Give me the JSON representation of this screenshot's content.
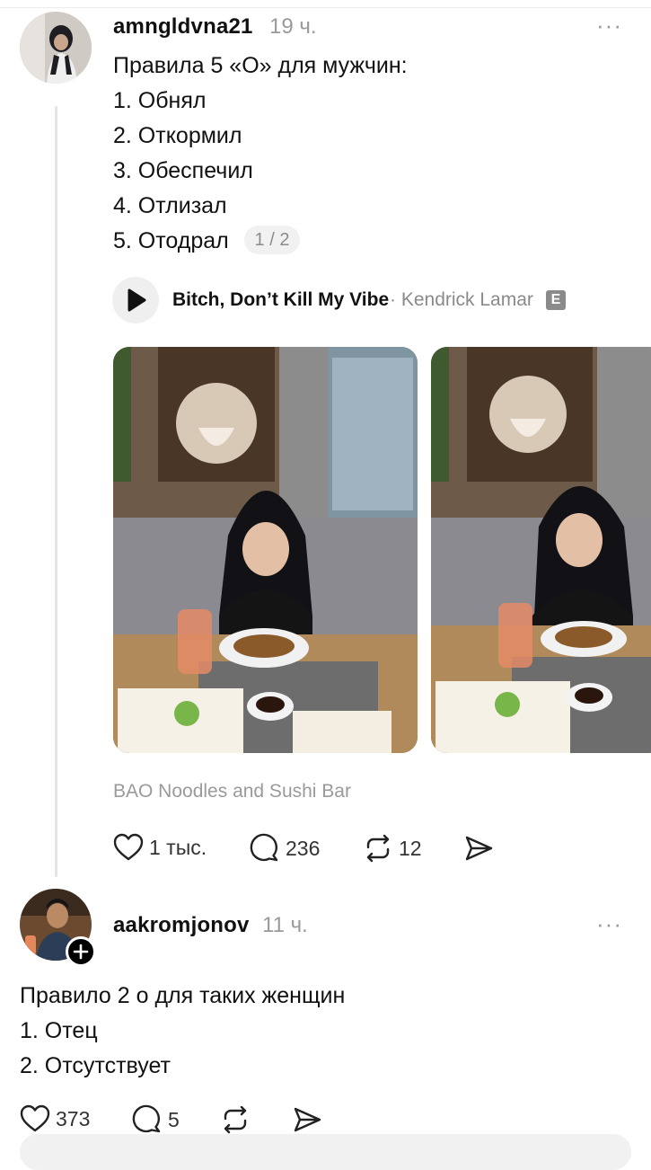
{
  "post": {
    "username": "amngldvna21",
    "time": "19 ч.",
    "more": "···",
    "lines": [
      "Правила 5 «О» для мужчин:",
      "1. Обнял",
      "2. Откормил",
      "3. Обеспечил",
      "4. Отлизал",
      "5. Отодрал"
    ],
    "pager": "1 / 2",
    "music": {
      "title": "Bitch, Don’t Kill My Vibe",
      "artist": "· Kendrick Lamar",
      "explicit": "E"
    },
    "photos": [
      {
        "icon": "restaurant-photo-woman-at-table"
      },
      {
        "icon": "restaurant-photo-woman-at-table"
      }
    ],
    "location": "BAO Noodles and Sushi Bar",
    "stats": {
      "likes": "1 тыс.",
      "comments": "236",
      "reposts": "12"
    }
  },
  "reply": {
    "username": "aakromjonov",
    "time": "11 ч.",
    "more": "···",
    "lines": [
      "Правило 2 о для таких женщин",
      "1. Отец",
      "2. Отсутствует"
    ],
    "stats": {
      "likes": "373",
      "comments": "5"
    }
  },
  "colors": {
    "text": "#101010",
    "muted": "#9a9a9a",
    "line": "#e4e4e4"
  }
}
